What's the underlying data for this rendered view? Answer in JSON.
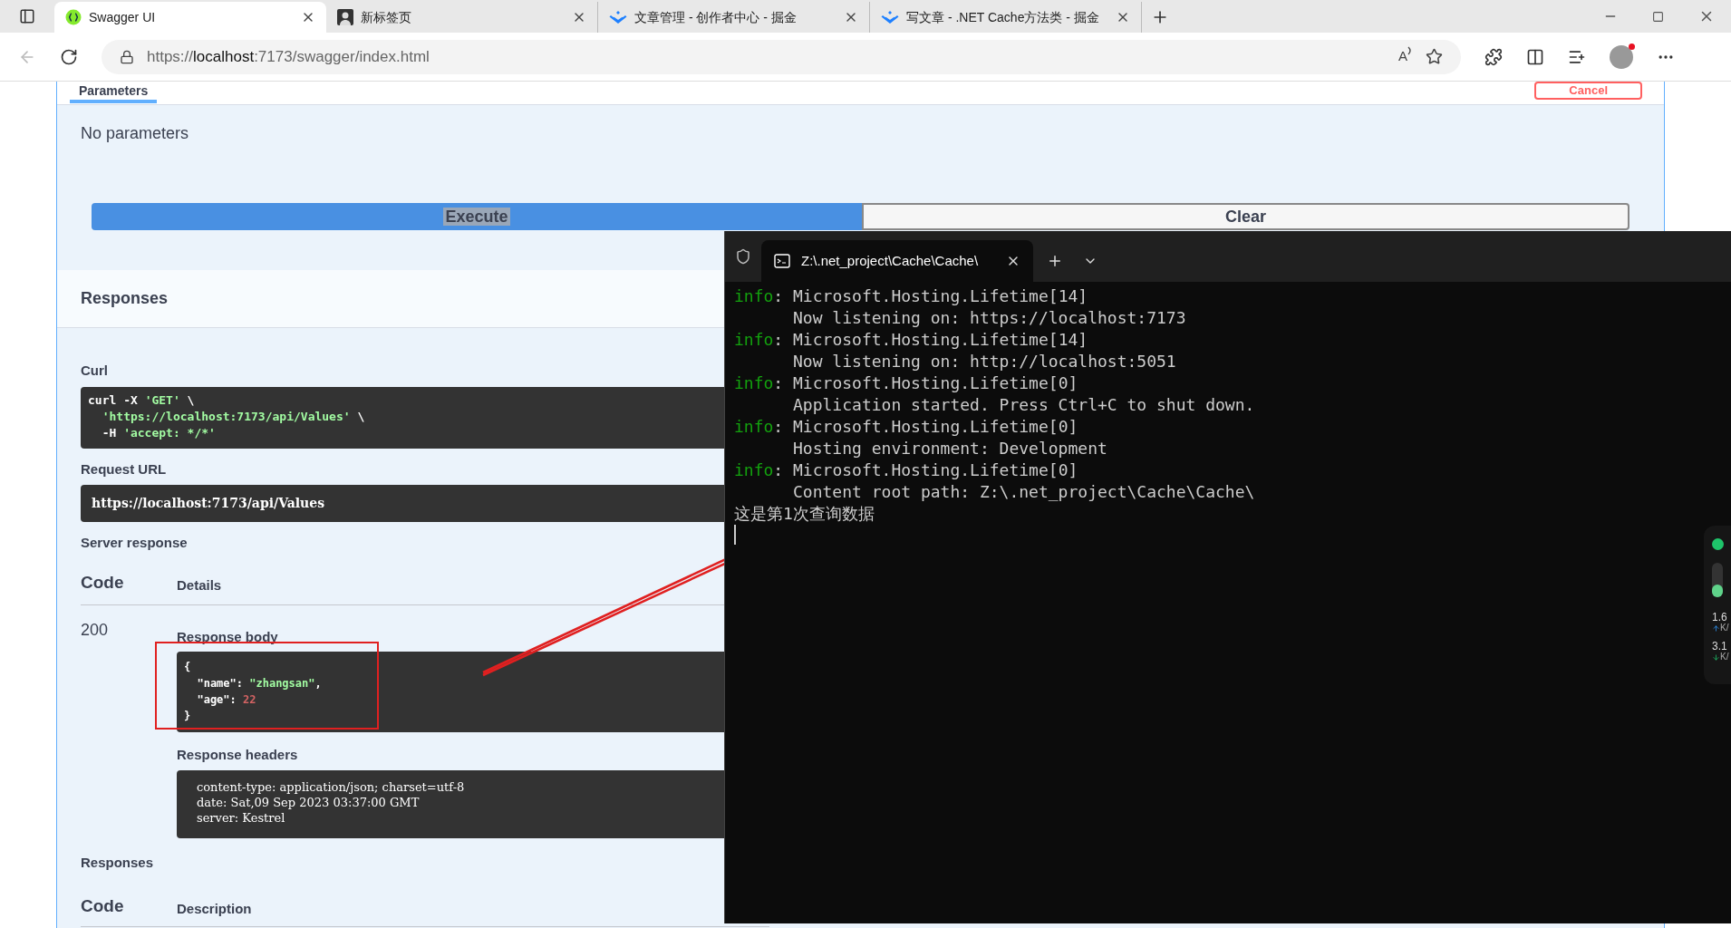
{
  "browser": {
    "tabs": [
      {
        "title": "Swagger UI",
        "selected": true,
        "kind": "swagger"
      },
      {
        "title": "新标签页",
        "selected": false,
        "kind": "newtab"
      },
      {
        "title": "文章管理 - 创作者中心 - 掘金",
        "selected": false,
        "kind": "juejin"
      },
      {
        "title": "写文章 - .NET Cache方法类 - 掘金",
        "selected": false,
        "kind": "juejin"
      }
    ],
    "read_aloud": "A",
    "url_prefix": "https://",
    "url_host": "localhost",
    "url_rest": ":7173/swagger/index.html"
  },
  "swagger": {
    "parameters_tab": "Parameters",
    "cancel": "Cancel",
    "no_parameters": "No parameters",
    "execute": "Execute",
    "clear": "Clear",
    "responses_title": "Responses",
    "curl_label": "Curl",
    "curl": [
      [
        {
          "kind": "plain",
          "text": "curl -X "
        },
        {
          "kind": "string",
          "text": "'GET'"
        },
        {
          "kind": "plain",
          "text": " \\"
        }
      ],
      [
        {
          "kind": "string",
          "text": "  'https://localhost:7173/api/Values'"
        },
        {
          "kind": "plain",
          "text": " \\"
        }
      ],
      [
        {
          "kind": "plain",
          "text": "  -H "
        },
        {
          "kind": "string",
          "text": "'accept: */*'"
        }
      ]
    ],
    "request_url_label": "Request URL",
    "request_url": "https://localhost:7173/api/Values",
    "server_response_label": "Server response",
    "code_heading": "Code",
    "details_heading": "Details",
    "status_code": "200",
    "response_body_label": "Response body",
    "body": [
      [
        {
          "kind": "plain",
          "text": "{"
        }
      ],
      [
        {
          "kind": "plain",
          "text": "  \"name\": "
        },
        {
          "kind": "string",
          "text": "\"zhangsan\""
        },
        {
          "kind": "plain",
          "text": ","
        }
      ],
      [
        {
          "kind": "plain",
          "text": "  \"age\": "
        },
        {
          "kind": "number",
          "text": "22"
        }
      ],
      [
        {
          "kind": "plain",
          "text": "}"
        }
      ]
    ],
    "response_headers_label": "Response headers",
    "headers": [
      "content-type: application/json; charset=utf-8",
      "date: Sat,09 Sep 2023 03:37:00 GMT",
      "server: Kestrel"
    ],
    "responses_label": "Responses",
    "code_heading_2": "Code",
    "description_heading": "Description"
  },
  "terminal": {
    "tab_title": "Z:\\.net_project\\Cache\\Cache\\",
    "lines": [
      {
        "kind": "info",
        "prefix": "info",
        "text": ": Microsoft.Hosting.Lifetime[14]"
      },
      {
        "kind": "plain",
        "text": "      Now listening on: https://localhost:7173"
      },
      {
        "kind": "info",
        "prefix": "info",
        "text": ": Microsoft.Hosting.Lifetime[14]"
      },
      {
        "kind": "plain",
        "text": "      Now listening on: http://localhost:5051"
      },
      {
        "kind": "info",
        "prefix": "info",
        "text": ": Microsoft.Hosting.Lifetime[0]"
      },
      {
        "kind": "plain",
        "text": "      Application started. Press Ctrl+C to shut down."
      },
      {
        "kind": "info",
        "prefix": "info",
        "text": ": Microsoft.Hosting.Lifetime[0]"
      },
      {
        "kind": "plain",
        "text": "      Hosting environment: Development"
      },
      {
        "kind": "info",
        "prefix": "info",
        "text": ": Microsoft.Hosting.Lifetime[0]"
      },
      {
        "kind": "plain",
        "text": "      Content root path: Z:\\.net_project\\Cache\\Cache\\"
      },
      {
        "kind": "plain",
        "text": "这是第1次查询数据"
      }
    ]
  },
  "net_widget": {
    "upload": "1.6",
    "upload_unit": "K/",
    "download": "3.1",
    "download_unit": "K/"
  }
}
